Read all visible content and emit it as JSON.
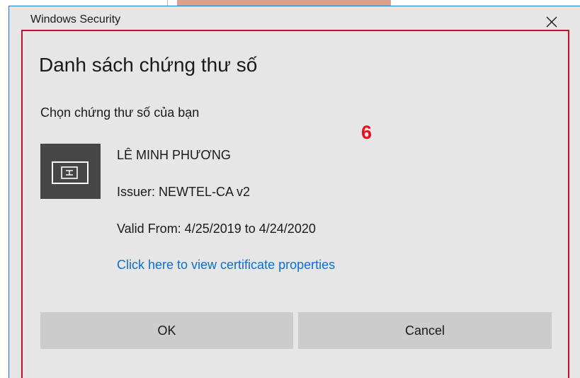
{
  "window": {
    "title": "Windows Security",
    "close_icon": "close-icon"
  },
  "dialog": {
    "heading": "Danh sách chứng thư số",
    "prompt": "Chọn chứng thư số của bạn"
  },
  "annotation": {
    "step_number": "6",
    "color": "#e8101e"
  },
  "certificate": {
    "icon": "certificate-card-icon",
    "name": "LÊ MINH PHƯƠNG",
    "issuer": "Issuer: NEWTEL-CA v2",
    "validity": "Valid From: 4/25/2019 to 4/24/2020",
    "properties_link": "Click here to view certificate properties"
  },
  "buttons": {
    "ok_label": "OK",
    "cancel_label": "Cancel"
  },
  "colors": {
    "dialog_background": "#e6e6e6",
    "link": "#0b6fd1",
    "button_background": "#cccccc",
    "highlight_border": "#c8102e",
    "window_border": "#1f74c9"
  }
}
